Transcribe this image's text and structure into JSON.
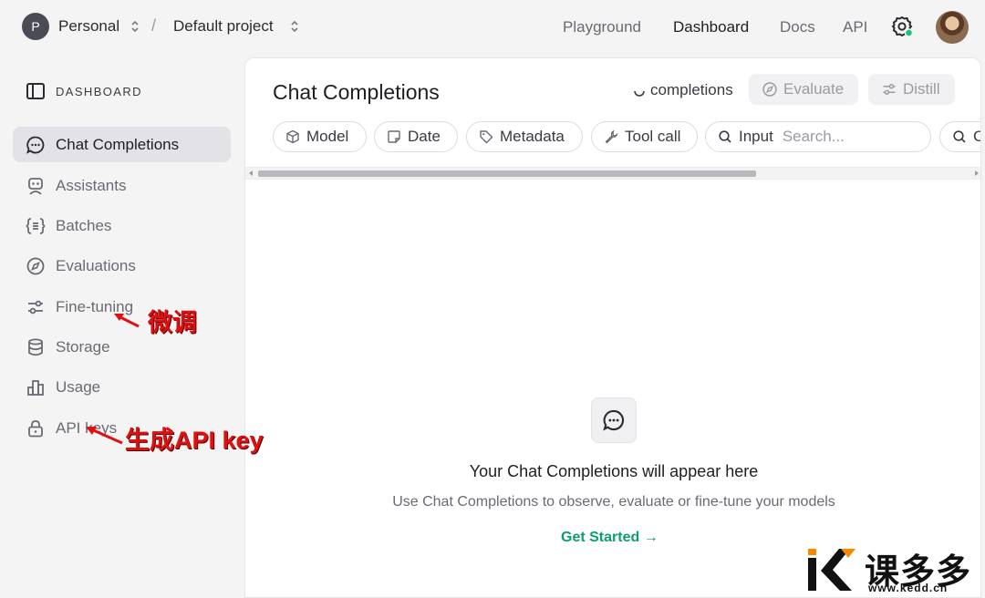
{
  "topbar": {
    "org_initial": "P",
    "org_name": "Personal",
    "separator": "/",
    "project_name": "Default project",
    "nav": [
      "Playground",
      "Dashboard",
      "Docs",
      "API"
    ],
    "active_nav": "Dashboard"
  },
  "sidebar": {
    "heading": "DASHBOARD",
    "items": [
      {
        "label": "Chat Completions",
        "icon": "chat-icon",
        "active": true
      },
      {
        "label": "Assistants",
        "icon": "assistant-icon",
        "active": false
      },
      {
        "label": "Batches",
        "icon": "batches-icon",
        "active": false
      },
      {
        "label": "Evaluations",
        "icon": "compass-icon",
        "active": false
      },
      {
        "label": "Fine-tuning",
        "icon": "sliders-icon",
        "active": false
      },
      {
        "label": "Storage",
        "icon": "database-icon",
        "active": false
      },
      {
        "label": "Usage",
        "icon": "bar-chart-icon",
        "active": false
      },
      {
        "label": "API keys",
        "icon": "lock-icon",
        "active": false
      }
    ]
  },
  "main": {
    "title": "Chat Completions",
    "status_label": "completions",
    "evaluate_label": "Evaluate",
    "distill_label": "Distill",
    "filters": {
      "model": "Model",
      "date": "Date",
      "metadata": "Metadata",
      "tool_call": "Tool call",
      "input": "Input",
      "input_placeholder": "Search...",
      "next_partial": "C"
    },
    "empty_state": {
      "title": "Your Chat Completions will appear here",
      "subtitle": "Use Chat Completions to observe, evaluate or fine-tune your models",
      "cta": "Get Started →"
    }
  },
  "annotations": {
    "fine_tuning_note": "微调",
    "api_key_note": "生成API key",
    "color": "#e01010"
  },
  "watermark": {
    "brand": "课多多",
    "url": "www.kedd.cn"
  },
  "colors": {
    "accent_green": "#0f9d6d",
    "sidebar_active_bg": "#e3e3e7"
  }
}
